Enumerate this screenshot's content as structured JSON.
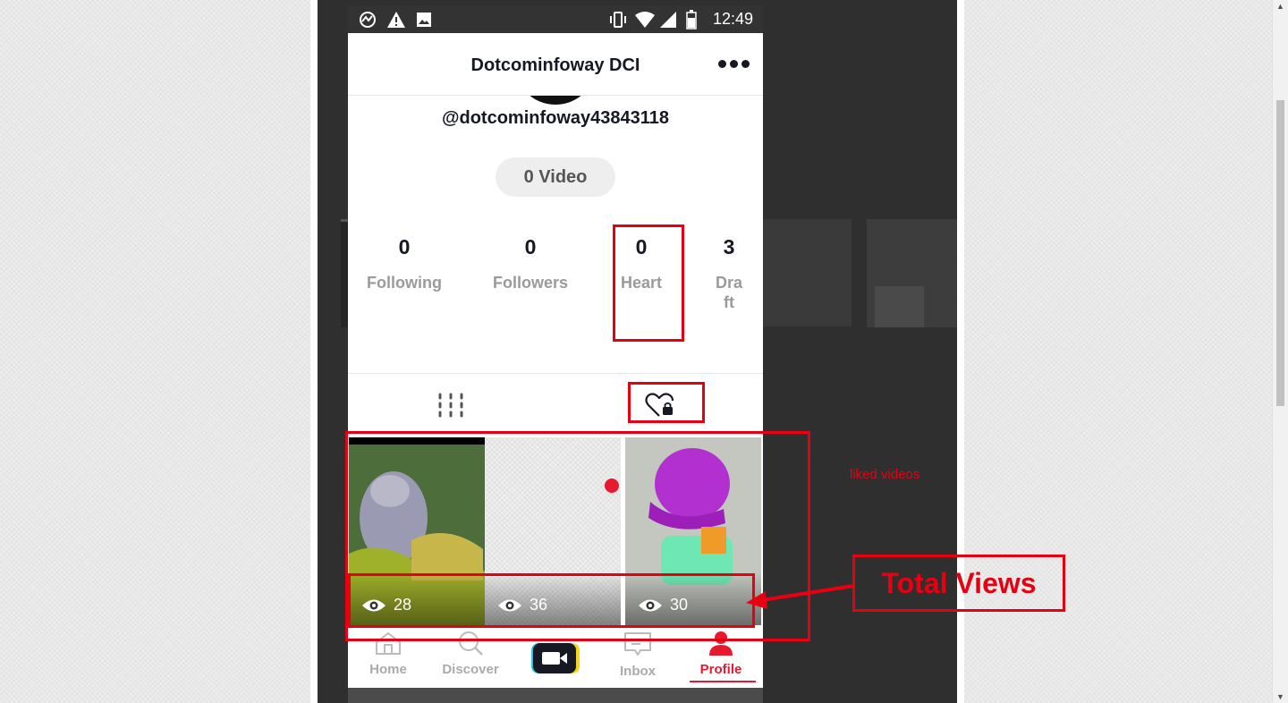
{
  "status_bar": {
    "time": "12:49",
    "icons": [
      "sync-icon",
      "warning-icon",
      "image-icon",
      "vibrate-icon",
      "wifi-icon",
      "signal-icon",
      "battery-icon"
    ]
  },
  "header": {
    "title": "Dotcominfoway DCI",
    "more_icon": "more-dots-icon"
  },
  "profile": {
    "username": "@dotcominfoway43843118",
    "video_count": "0 Video"
  },
  "stats": [
    {
      "value": "0",
      "label": "Following"
    },
    {
      "value": "0",
      "label": "Followers"
    },
    {
      "value": "0",
      "label": "Heart"
    },
    {
      "value": "3",
      "label": "Dra ft"
    }
  ],
  "tabs": [
    {
      "icon": "grid-icon",
      "active": false
    },
    {
      "icon": "liked-private-icon",
      "active": true
    }
  ],
  "videos": [
    {
      "views": "28"
    },
    {
      "views": "36"
    },
    {
      "views": "30"
    }
  ],
  "tabbar": [
    {
      "label": "Home",
      "icon": "home-icon",
      "active": false
    },
    {
      "label": "Discover",
      "icon": "search-icon",
      "active": false
    },
    {
      "label": "",
      "icon": "record-icon",
      "active": false
    },
    {
      "label": "Inbox",
      "icon": "inbox-icon",
      "active": false
    },
    {
      "label": "Profile",
      "icon": "profile-icon",
      "active": true
    }
  ],
  "annotations": {
    "liked_videos": "liked videos",
    "total_views": "Total Views"
  },
  "colors": {
    "accent": "#e6192e",
    "annotation": "#e60012",
    "text_primary": "#161823",
    "text_secondary": "#9a9a9a"
  }
}
